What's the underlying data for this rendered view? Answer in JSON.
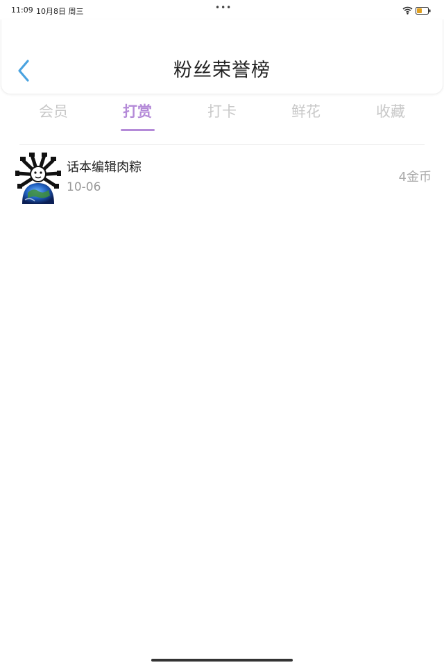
{
  "status_bar": {
    "time": "11:09",
    "date": "10月8日 周三",
    "dots": "•••",
    "icons": [
      "wifi-icon",
      "battery-icon"
    ]
  },
  "header": {
    "title": "粉丝荣誉榜",
    "back_icon": "chevron-left-icon"
  },
  "tabs": [
    {
      "label": "会员",
      "active": false
    },
    {
      "label": "打赏",
      "active": true
    },
    {
      "label": "打卡",
      "active": false
    },
    {
      "label": "鲜花",
      "active": false
    },
    {
      "label": "收藏",
      "active": false
    }
  ],
  "list": [
    {
      "name": "话本编辑肉粽",
      "date": "10-06",
      "amount": "4金币",
      "avatar_icon": "cartoon-globe-avatar"
    }
  ],
  "colors": {
    "accent": "#b48ad8",
    "back_icon": "#4aa3e0",
    "inactive_tab": "#c8c8c8",
    "secondary_text": "#999999"
  }
}
